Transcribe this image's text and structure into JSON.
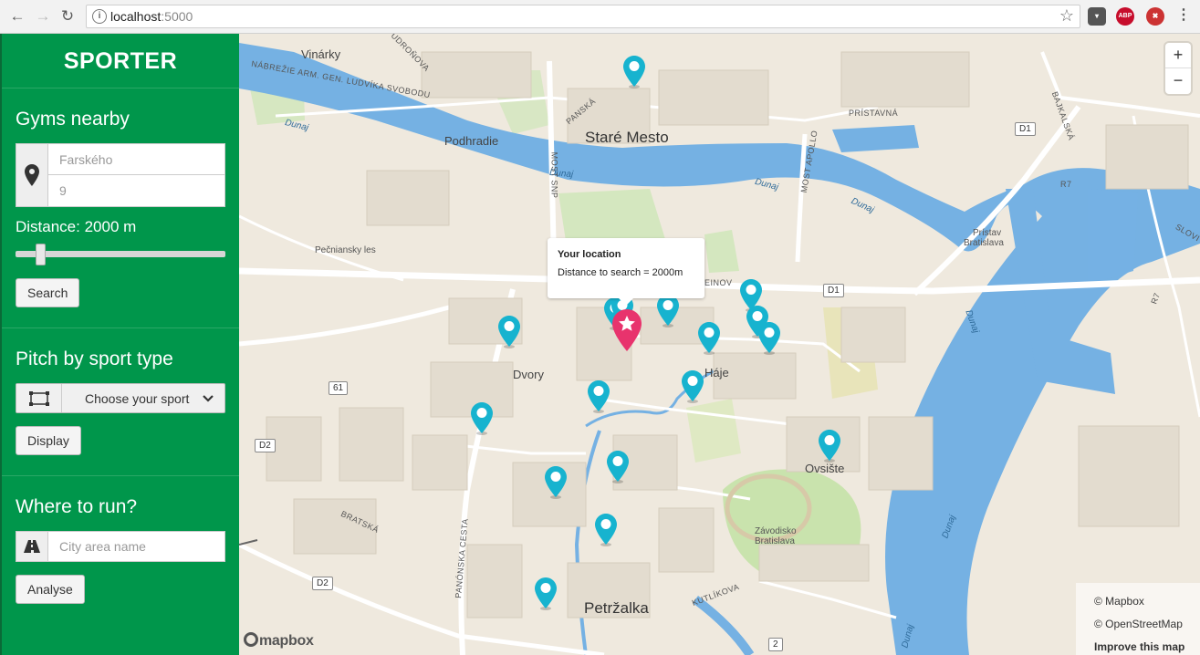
{
  "browser": {
    "url_host": "localhost",
    "url_port": ":5000"
  },
  "sidebar": {
    "brand": "SPORTER",
    "gyms": {
      "title": "Gyms nearby",
      "street_placeholder": "Farského",
      "number_placeholder": "9",
      "distance_label": "Distance: 2000 m",
      "distance_value_m": 2000,
      "search_button": "Search"
    },
    "pitch": {
      "title": "Pitch by sport type",
      "select_value": "Choose your sport",
      "display_button": "Display"
    },
    "run": {
      "title": "Where to run?",
      "placeholder": "City area name",
      "analyse_button": "Analyse"
    }
  },
  "map": {
    "popup": {
      "title": "Your location",
      "text": "Distance to search = 2000m"
    },
    "zoom_in": "+",
    "zoom_out": "−",
    "attribution": {
      "mapbox": "© Mapbox",
      "osm": "© OpenStreetMap",
      "improve": "Improve this map"
    },
    "logo": "mapbox",
    "labels": {
      "stare_mesto": "Staré Mesto",
      "petrzalka": "Petržalka",
      "dvory": "Dvory",
      "haje": "Háje",
      "ovsiste": "Ovsište",
      "vinarky": "Vinárky",
      "podhradie": "Podhradie",
      "pecniansky_les": "Pečniansky les",
      "zavodisko": "Závodisko",
      "bratislava": "Bratislava",
      "pristav": "Prístav",
      "pristav2": "Bratislava",
      "dunaj1": "Dunaj",
      "dunaj2": "Dunaj",
      "dunaj3": "Dunaj",
      "dunaj4": "Dunaj",
      "dunaj5": "Dunaj",
      "dunaj6": "Dunaj",
      "dunaj7": "Dunaj",
      "nabrezie": "NÁBREŽIE ARM. GEN. LUDVÍKA SVOBODU",
      "udronova": "UDROŇOVA",
      "panska": "PANSKÁ",
      "most_snp": "MOST SNP",
      "most_apollo": "MOST APOLLO",
      "pristavna": "PRÍSTAVNÁ",
      "bajkalska": "BAJKALSKÁ",
      "slovi": "SLOVI",
      "einov": "EINOV",
      "bratska": "BRATSKÁ",
      "panonska": "PANÓNSKA CESTA",
      "kutlikova": "KUTLÍKOVA",
      "r7a": "R7",
      "r7b": "R7",
      "d1a": "D1",
      "d1b": "D1",
      "d2a": "D2",
      "d2b": "D2",
      "n61": "61",
      "n2": "2"
    },
    "markers": [
      {
        "name": "gym-marker"
      },
      {
        "name": "gym-marker"
      },
      {
        "name": "gym-marker"
      },
      {
        "name": "gym-marker"
      },
      {
        "name": "gym-marker"
      },
      {
        "name": "gym-marker"
      },
      {
        "name": "gym-marker"
      },
      {
        "name": "gym-marker"
      },
      {
        "name": "gym-marker"
      },
      {
        "name": "gym-marker"
      },
      {
        "name": "gym-marker"
      },
      {
        "name": "gym-marker"
      },
      {
        "name": "gym-marker"
      },
      {
        "name": "gym-marker"
      },
      {
        "name": "gym-marker"
      },
      {
        "name": "gym-marker"
      },
      {
        "name": "gym-marker"
      }
    ],
    "colors": {
      "sidebar": "#00964b",
      "water": "#75b1e3",
      "gym_marker": "#17b3cf",
      "location_marker": "#e8336d"
    }
  }
}
